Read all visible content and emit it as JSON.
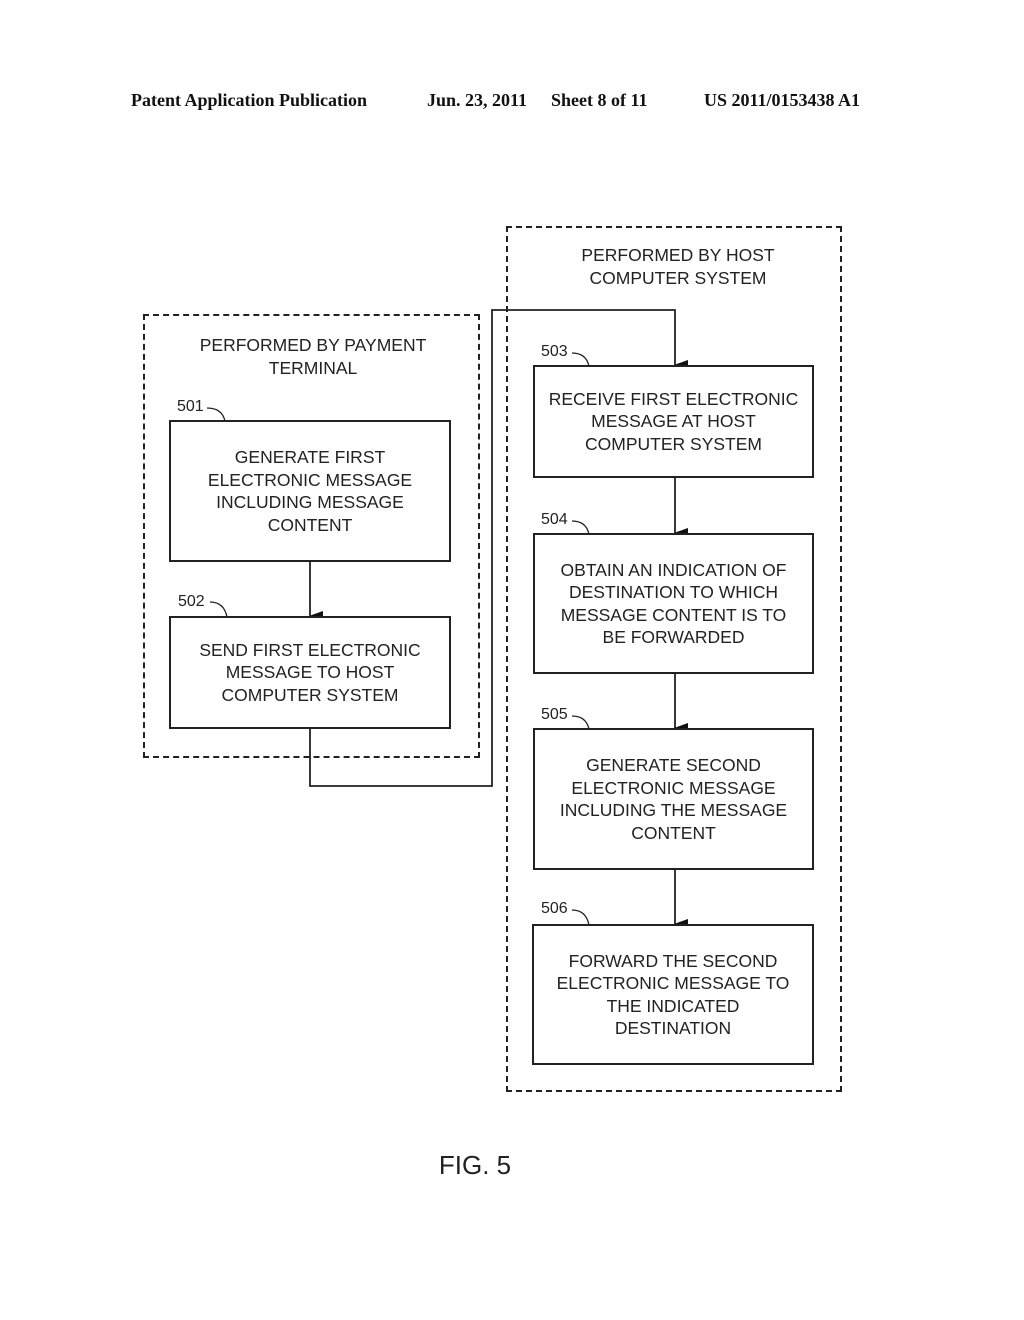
{
  "header": {
    "publication": "Patent Application Publication",
    "date": "Jun. 23, 2011",
    "sheet": "Sheet 8 of 11",
    "number": "US 2011/0153438 A1"
  },
  "lanes": [
    {
      "id": "payment-terminal",
      "title_lines": [
        "PERFORMED BY PAYMENT",
        "TERMINAL"
      ]
    },
    {
      "id": "host-computer",
      "title_lines": [
        "PERFORMED BY HOST",
        "COMPUTER SYSTEM"
      ]
    }
  ],
  "steps": [
    {
      "ref": "501",
      "lane": "payment-terminal",
      "lines": [
        "GENERATE FIRST",
        "ELECTRONIC MESSAGE",
        "INCLUDING MESSAGE",
        "CONTENT"
      ]
    },
    {
      "ref": "502",
      "lane": "payment-terminal",
      "lines": [
        "SEND FIRST ELECTRONIC",
        "MESSAGE TO HOST",
        "COMPUTER SYSTEM"
      ]
    },
    {
      "ref": "503",
      "lane": "host-computer",
      "lines": [
        "RECEIVE FIRST ELECTRONIC",
        "MESSAGE AT HOST",
        "COMPUTER SYSTEM"
      ]
    },
    {
      "ref": "504",
      "lane": "host-computer",
      "lines": [
        "OBTAIN AN INDICATION OF",
        "DESTINATION TO WHICH",
        "MESSAGE CONTENT IS TO",
        "BE FORWARDED"
      ]
    },
    {
      "ref": "505",
      "lane": "host-computer",
      "lines": [
        "GENERATE SECOND",
        "ELECTRONIC MESSAGE",
        "INCLUDING THE MESSAGE",
        "CONTENT"
      ]
    },
    {
      "ref": "506",
      "lane": "host-computer",
      "lines": [
        "FORWARD THE SECOND",
        "ELECTRONIC MESSAGE TO",
        "THE INDICATED",
        "DESTINATION"
      ]
    }
  ],
  "flow": [
    {
      "from": "501",
      "to": "502"
    },
    {
      "from": "502",
      "to": "503"
    },
    {
      "from": "503",
      "to": "504"
    },
    {
      "from": "504",
      "to": "505"
    },
    {
      "from": "505",
      "to": "506"
    }
  ],
  "figure_label": "FIG. 5"
}
